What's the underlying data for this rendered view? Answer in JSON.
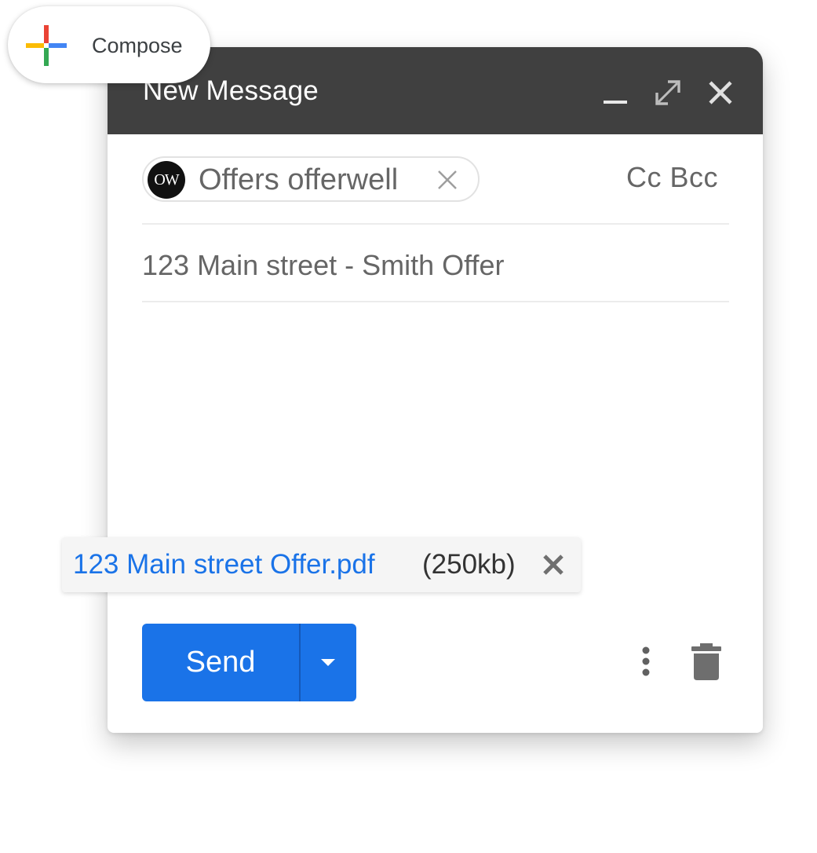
{
  "compose_button": {
    "label": "Compose",
    "icon": "colored-plus-icon",
    "colors": {
      "red": "#ea4335",
      "blue": "#4285f4",
      "green": "#34a853",
      "yellow": "#fbbc05"
    }
  },
  "dialog": {
    "title": "New Message",
    "titlebar_color": "#404040",
    "controls": [
      "minimize-icon",
      "expand-icon",
      "close-icon"
    ]
  },
  "to": {
    "recipient_name": "Offers offerwell",
    "avatar_text": "OW",
    "cc_bcc": "Cc Bcc"
  },
  "subject": {
    "value": "123 Main street - Smith Offer"
  },
  "attachment": {
    "filename": "123 Main street Offer.pdf",
    "size": "(250kb)"
  },
  "footer": {
    "send_label": "Send",
    "accent": "#1a73e8",
    "icons": [
      "dropdown-arrow-icon",
      "more-vert-icon",
      "trash-icon"
    ]
  }
}
